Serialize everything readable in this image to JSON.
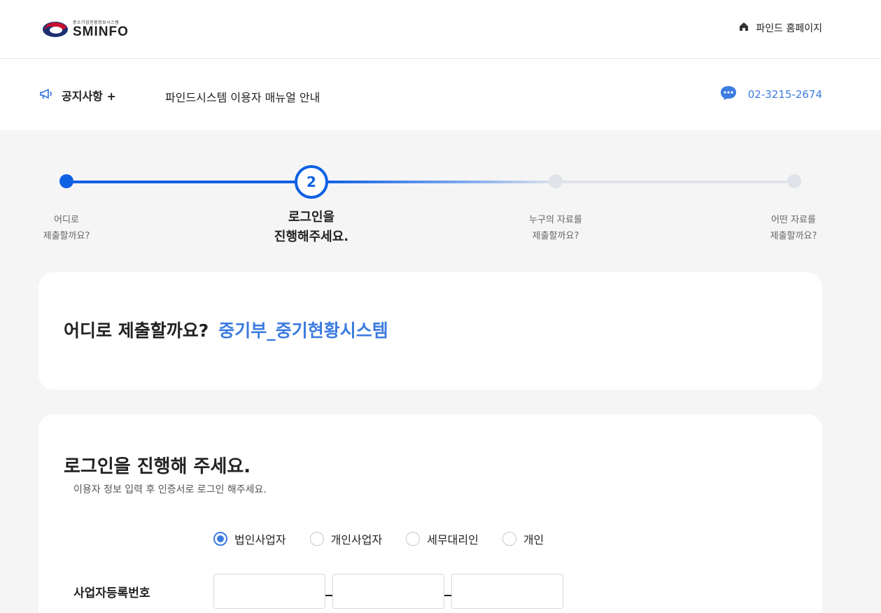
{
  "header": {
    "logo_sub": "중소기업현황정보시스템",
    "logo_main": "SMINFO",
    "home_link": "파인드 홈페이지"
  },
  "notice": {
    "title": "공지사항 +",
    "text": "파인드시스템 이용자 매뉴얼 안내",
    "phone": "02-3215-2674"
  },
  "stepper": {
    "current_step": 2,
    "steps": [
      {
        "line1": "어디로",
        "line2": "제출할까요?"
      },
      {
        "line1": "로그인을",
        "line2": "진행해주세요."
      },
      {
        "line1": "누구의 자료를",
        "line2": "제출할까요?"
      },
      {
        "line1": "어떤 자료를",
        "line2": "제출할까요?"
      }
    ]
  },
  "destination": {
    "question": "어디로 제출할까요?",
    "answer": "중기부_중기현황시스템"
  },
  "login": {
    "title": "로그인을 진행해 주세요.",
    "subtitle": "이용자 정보 입력 후 인증서로 로그인 해주세요.",
    "user_types": [
      "법인사업자",
      "개인사업자",
      "세무대리인",
      "개인"
    ],
    "selected_type": "법인사업자",
    "biz_number_label": "사업자등록번호",
    "biz_number_values": [
      "",
      "",
      ""
    ]
  },
  "colors": {
    "accent": "#0f61e3",
    "link_blue": "#3d7ce0",
    "background": "#f5f5f6"
  }
}
